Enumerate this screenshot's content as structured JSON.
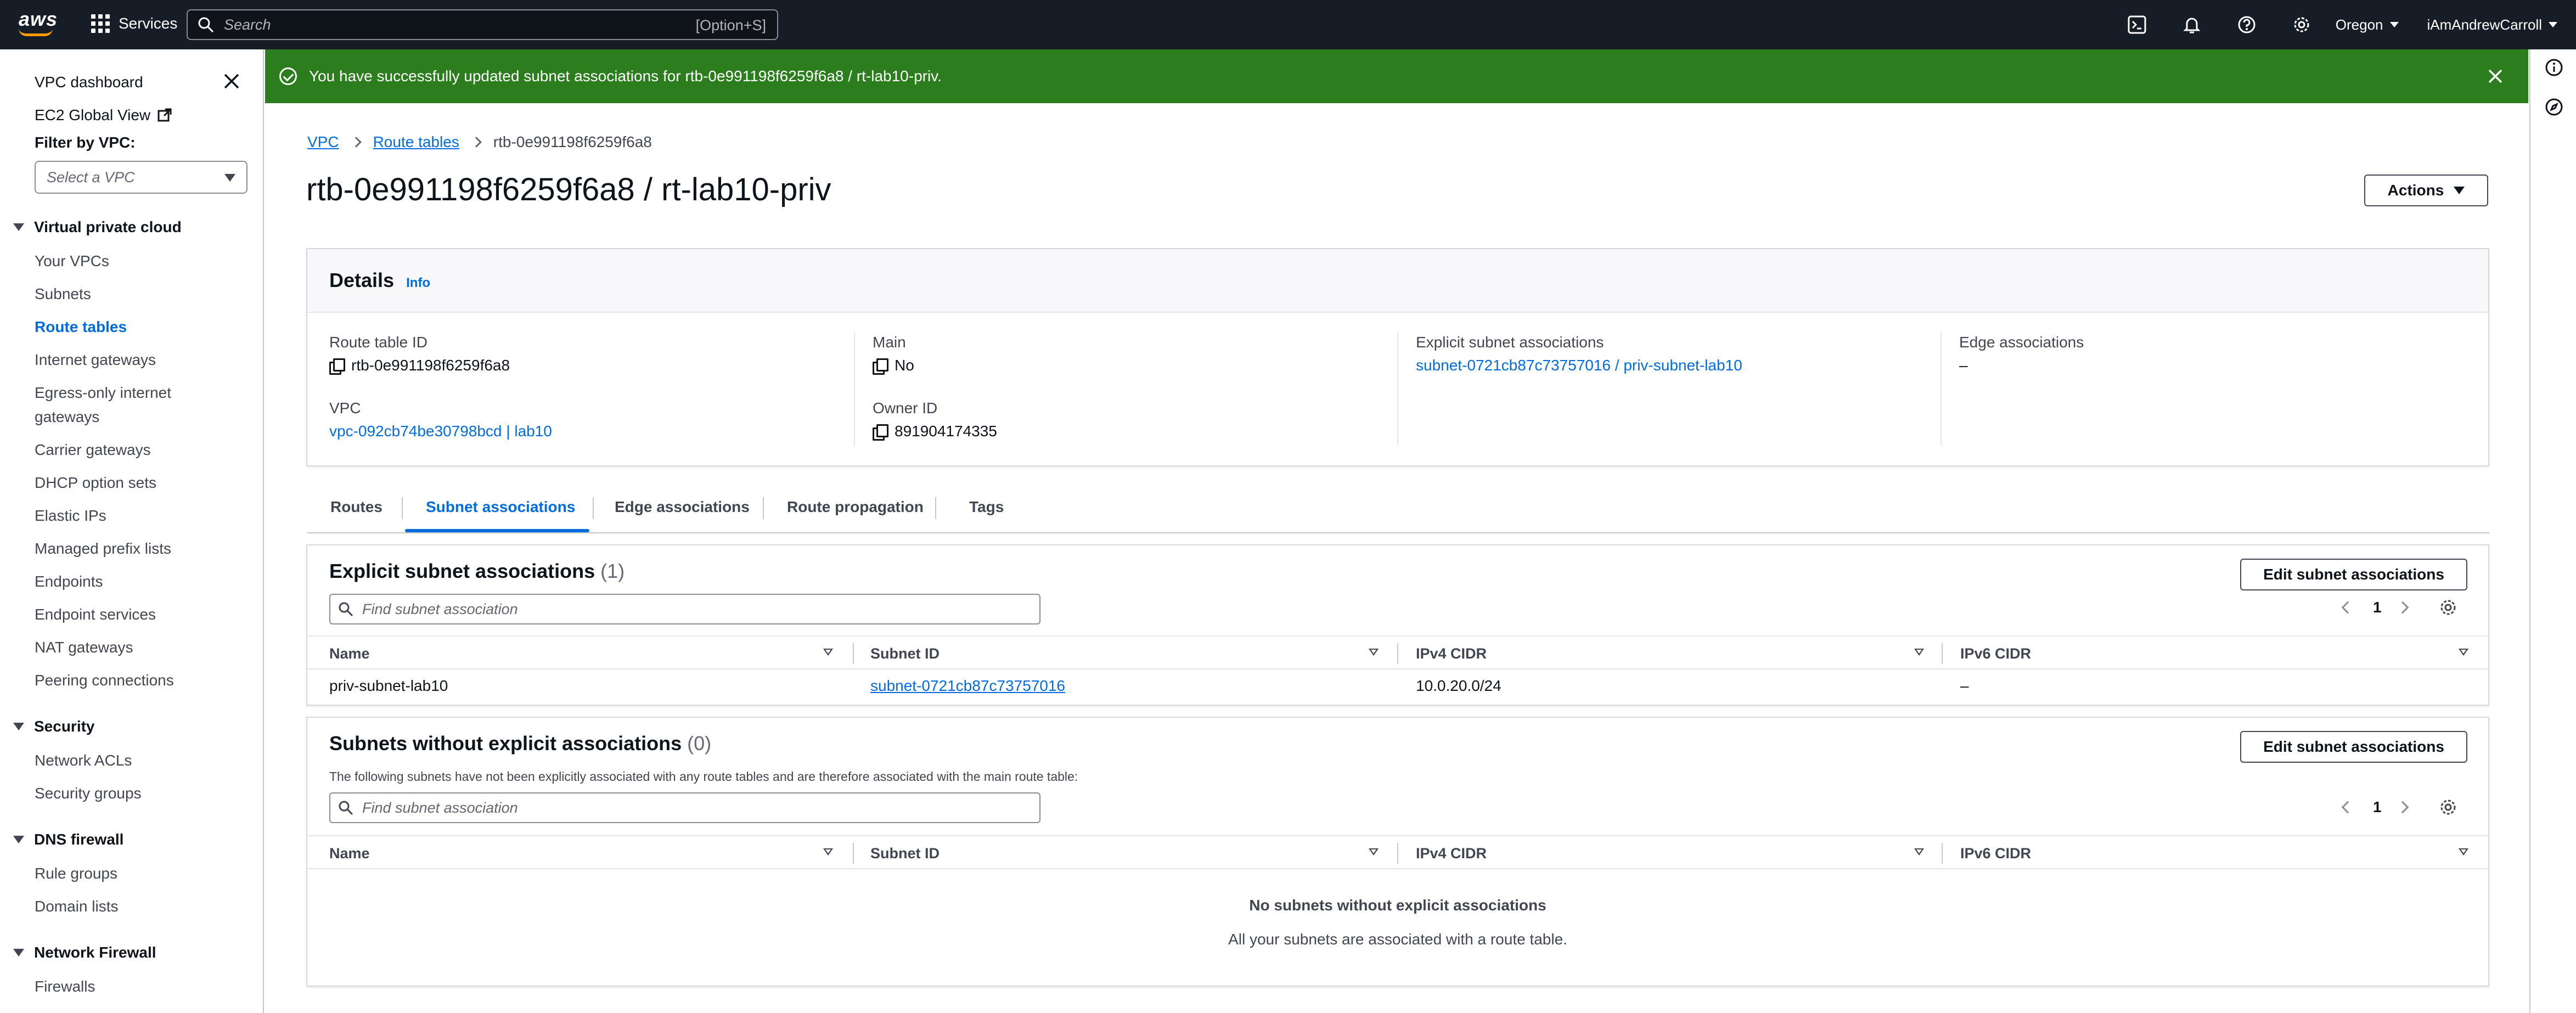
{
  "topbar": {
    "logo": "aws",
    "services_label": "Services",
    "search_placeholder": "Search",
    "search_shortcut": "[Option+S]",
    "region": "Oregon",
    "user": "iAmAndrewCarroll",
    "icons": [
      "cloudshell-icon",
      "bell-icon",
      "help-icon",
      "settings-icon"
    ]
  },
  "sidebar": {
    "dashboard": "VPC dashboard",
    "ec2_global_view": "EC2 Global View",
    "filter_label": "Filter by VPC:",
    "filter_placeholder": "Select a VPC",
    "sections": [
      {
        "title": "Virtual private cloud",
        "items": [
          "Your VPCs",
          "Subnets",
          "Route tables",
          "Internet gateways",
          "Egress-only internet",
          "gateways",
          "Carrier gateways",
          "DHCP option sets",
          "Elastic IPs",
          "Managed prefix lists",
          "Endpoints",
          "Endpoint services",
          "NAT gateways",
          "Peering connections"
        ]
      },
      {
        "title": "Security",
        "items": [
          "Network ACLs",
          "Security groups"
        ]
      },
      {
        "title": "DNS firewall",
        "items": [
          "Rule groups",
          "Domain lists"
        ]
      },
      {
        "title": "Network Firewall",
        "items": [
          "Firewalls"
        ]
      }
    ],
    "active_item": "Route tables"
  },
  "banner": {
    "message": "You have successfully updated subnet associations for rtb-0e991198f6259f6a8 / rt-lab10-priv."
  },
  "breadcrumb": {
    "items": [
      "VPC",
      "Route tables",
      "rtb-0e991198f6259f6a8"
    ]
  },
  "page": {
    "title": "rtb-0e991198f6259f6a8 / rt-lab10-priv",
    "actions_label": "Actions"
  },
  "details": {
    "title": "Details",
    "info": "Info",
    "route_table_id_label": "Route table ID",
    "route_table_id": "rtb-0e991198f6259f6a8",
    "main_label": "Main",
    "main": "No",
    "explicit_label": "Explicit subnet associations",
    "explicit": "subnet-0721cb87c73757016 / priv-subnet-lab10",
    "edge_label": "Edge associations",
    "edge": "–",
    "vpc_label": "VPC",
    "vpc": "vpc-092cb74be30798bcd | lab10",
    "owner_label": "Owner ID",
    "owner": "891904174335"
  },
  "tabs": [
    "Routes",
    "Subnet associations",
    "Edge associations",
    "Route propagation",
    "Tags"
  ],
  "active_tab": "Subnet associations",
  "explicit_table": {
    "title": "Explicit subnet associations",
    "count": "(1)",
    "edit_label": "Edit subnet associations",
    "filter_placeholder": "Find subnet association",
    "page": "1",
    "columns": [
      "Name",
      "Subnet ID",
      "IPv4 CIDR",
      "IPv6 CIDR"
    ],
    "rows": [
      {
        "name": "priv-subnet-lab10",
        "subnet_id": "subnet-0721cb87c73757016",
        "ipv4": "10.0.20.0/24",
        "ipv6": "–"
      }
    ]
  },
  "implicit_table": {
    "title": "Subnets without explicit associations",
    "count": "(0)",
    "description": "The following subnets have not been explicitly associated with any route tables and are therefore associated with the main route table:",
    "edit_label": "Edit subnet associations",
    "filter_placeholder": "Find subnet association",
    "page": "1",
    "columns": [
      "Name",
      "Subnet ID",
      "IPv4 CIDR",
      "IPv6 CIDR"
    ],
    "empty_title": "No subnets without explicit associations",
    "empty_sub": "All your subnets are associated with a route table."
  },
  "colors": {
    "topbar": "#161d26",
    "banner": "#2b7d1e",
    "link": "#006ce0",
    "accent": "#ff9900"
  }
}
